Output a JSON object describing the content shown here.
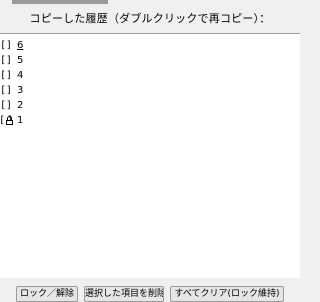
{
  "header": {
    "title": "コピーした履歴（ダブルクリックで再コピー）："
  },
  "list": {
    "items": [
      {
        "text": "6",
        "locked": false
      },
      {
        "text": "5",
        "locked": false
      },
      {
        "text": "4",
        "locked": false
      },
      {
        "text": "3",
        "locked": false
      },
      {
        "text": "2",
        "locked": false
      },
      {
        "text": "1",
        "locked": true
      }
    ],
    "unlocked_open": "[",
    "unlocked_close": "]"
  },
  "buttons": {
    "lock_toggle": "ロック／解除",
    "delete_selected": "選択した項目を削除",
    "clear_all": "すべてクリア(ロック維持)"
  },
  "icons": {
    "lock": "lock-icon"
  }
}
